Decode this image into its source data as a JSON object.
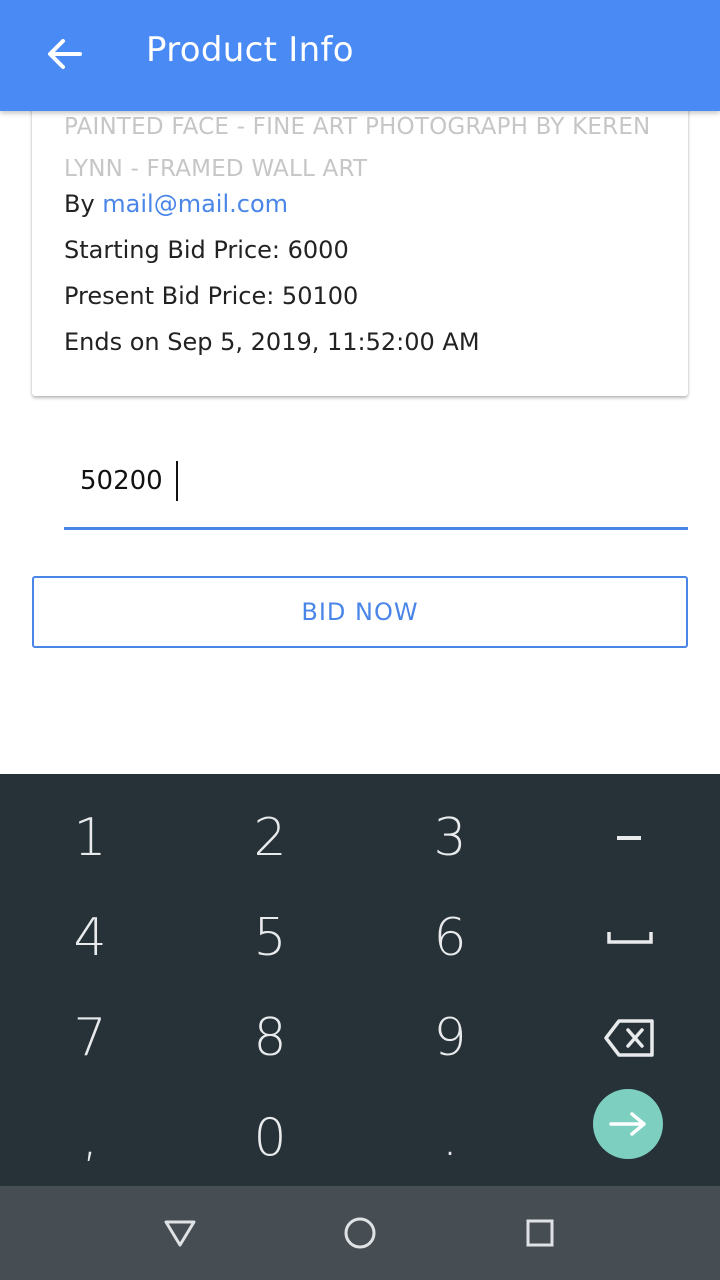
{
  "app_bar": {
    "title": "Product Info",
    "back_icon": "arrow-left-icon",
    "color": "#4a8af4"
  },
  "product": {
    "title": "PAINTED FACE - FINE ART PHOTOGRAPH BY KEREN LYNN - FRAMED WALL ART",
    "by_label": "By ",
    "seller_email": "mail@mail.com",
    "starting_bid": "Starting Bid Price: 6000",
    "present_bid": "Present Bid Price: 50100",
    "ends_on": "Ends on Sep 5, 2019, 11:52:00 AM"
  },
  "bid_form": {
    "input_value": "50200",
    "button_label": "BID NOW",
    "accent_color": "#4a86e8"
  },
  "keyboard": {
    "background": "#263238",
    "rows": [
      [
        "1",
        "2",
        "3",
        "-"
      ],
      [
        "4",
        "5",
        "6",
        "space"
      ],
      [
        "7",
        "8",
        "9",
        "backspace"
      ],
      [
        ",",
        "0",
        ".",
        "enter"
      ]
    ],
    "icons": {
      "space": "space-bar-icon",
      "backspace": "backspace-icon",
      "enter": "arrow-right-icon"
    },
    "enter_color": "#7dcfbf"
  },
  "nav_bar": {
    "buttons": [
      "back-triangle-icon",
      "home-circle-icon",
      "recents-square-icon"
    ]
  }
}
